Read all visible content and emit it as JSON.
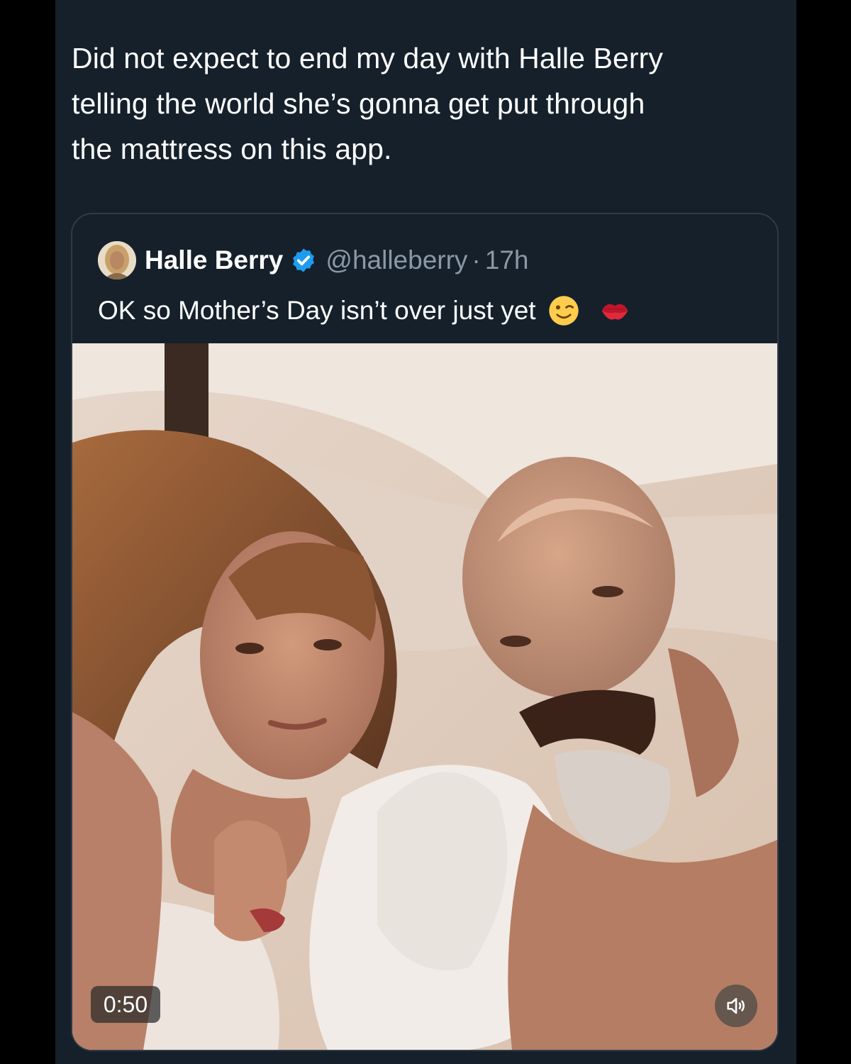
{
  "tweet": {
    "text_line1": "Did not expect to end my day with Halle Berry",
    "text_line2": "telling the world she’s gonna get put through",
    "text_line3": "the mattress on this app."
  },
  "quoted_tweet": {
    "display_name": "Halle Berry",
    "verified": true,
    "handle": "@halleberry",
    "separator": "·",
    "time": "17h",
    "text": "OK so Mother’s Day isn’t over just yet",
    "emojis": [
      "winking-face-icon",
      "kiss-mark-icon"
    ],
    "video": {
      "duration": "0:50",
      "sound_icon": "speaker-muted-icon"
    }
  },
  "colors": {
    "background": "#15202b",
    "text": "#ffffff",
    "secondary_text": "#8b98a5",
    "verified_badge": "#1d9bf0",
    "card_border": "#2f3a46"
  }
}
